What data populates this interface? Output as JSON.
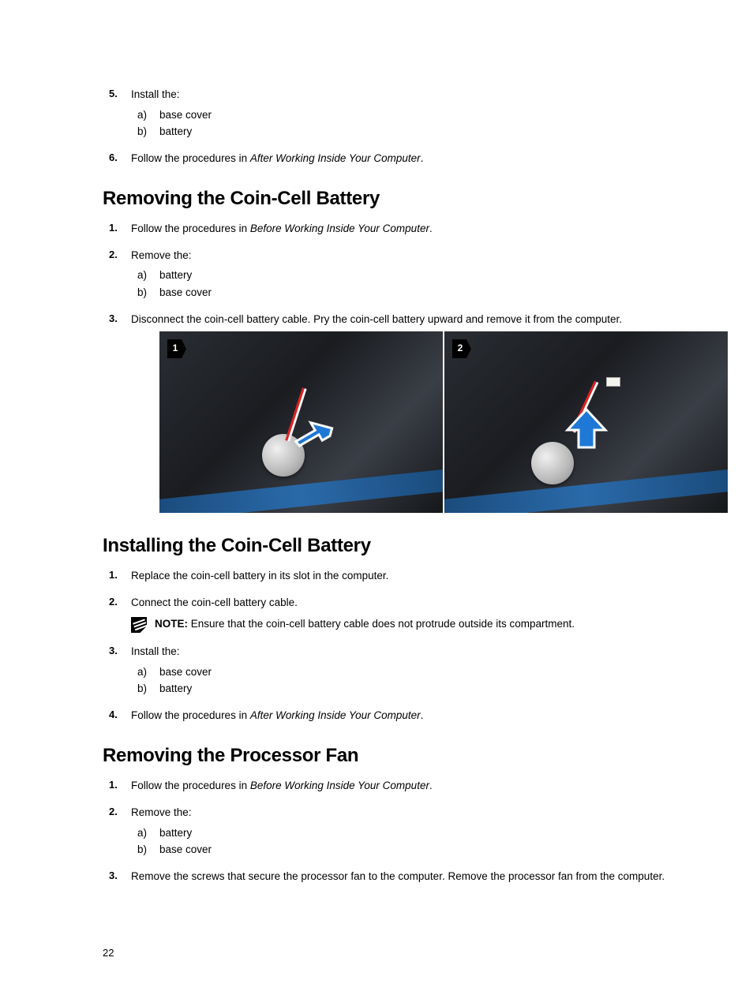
{
  "section_a": {
    "step5": {
      "num": "5.",
      "text": "Install the:",
      "items": [
        {
          "a": "a)",
          "t": "base cover"
        },
        {
          "a": "b)",
          "t": "battery"
        }
      ]
    },
    "step6": {
      "num": "6.",
      "text_before": "Follow the procedures in ",
      "text_italic": "After Working Inside Your Computer",
      "text_after": "."
    }
  },
  "heading_removing_coin": "Removing the Coin-Cell Battery",
  "removing_coin": {
    "step1": {
      "num": "1.",
      "text_before": "Follow the procedures in ",
      "text_italic": "Before Working Inside Your Computer",
      "text_after": "."
    },
    "step2": {
      "num": "2.",
      "text": "Remove the:",
      "items": [
        {
          "a": "a)",
          "t": "battery"
        },
        {
          "a": "b)",
          "t": "base cover"
        }
      ]
    },
    "step3": {
      "num": "3.",
      "text": "Disconnect the coin-cell battery cable. Pry the coin-cell battery upward and remove it from the computer."
    },
    "fig_badges": {
      "one": "1",
      "two": "2"
    }
  },
  "heading_installing_coin": "Installing the Coin-Cell Battery",
  "installing_coin": {
    "step1": {
      "num": "1.",
      "text": "Replace the coin-cell battery in its slot in the computer."
    },
    "step2": {
      "num": "2.",
      "text": "Connect the coin-cell battery cable.",
      "note_prefix": "NOTE: ",
      "note_text": "Ensure that the coin-cell battery cable does not protrude outside its compartment."
    },
    "step3": {
      "num": "3.",
      "text": "Install the:",
      "items": [
        {
          "a": "a)",
          "t": "base cover"
        },
        {
          "a": "b)",
          "t": "battery"
        }
      ]
    },
    "step4": {
      "num": "4.",
      "text_before": "Follow the procedures in ",
      "text_italic": "After Working Inside Your Computer",
      "text_after": "."
    }
  },
  "heading_removing_fan": "Removing the Processor Fan",
  "removing_fan": {
    "step1": {
      "num": "1.",
      "text_before": "Follow the procedures in ",
      "text_italic": "Before Working Inside Your Computer",
      "text_after": "."
    },
    "step2": {
      "num": "2.",
      "text": "Remove the:",
      "items": [
        {
          "a": "a)",
          "t": "battery"
        },
        {
          "a": "b)",
          "t": "base cover"
        }
      ]
    },
    "step3": {
      "num": "3.",
      "text": "Remove the screws that secure the processor fan to the computer. Remove the processor fan from the computer."
    }
  },
  "page_number": "22"
}
